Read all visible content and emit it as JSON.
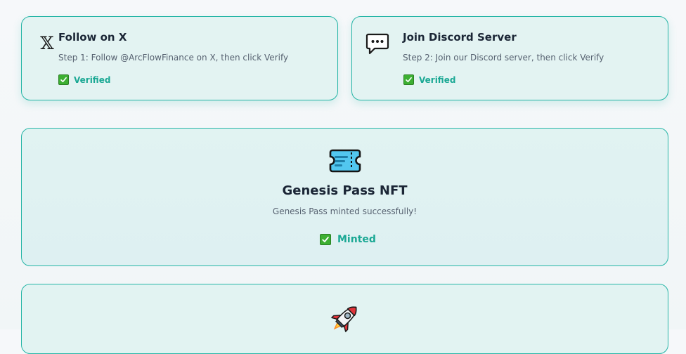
{
  "steps": [
    {
      "icon": "x-logo-icon",
      "icon_glyph": "𝕏",
      "title": "Follow on X",
      "description": "Step 1: Follow @ArcFlowFinance on X, then click Verify",
      "status": "Verified"
    },
    {
      "icon": "chat-bubble-icon",
      "title": "Join Discord Server",
      "description": "Step 2: Join our Discord server, then click Verify",
      "status": "Verified"
    }
  ],
  "nft": {
    "icon": "ticket-icon",
    "title": "Genesis Pass NFT",
    "description": "Genesis Pass minted successfully!",
    "status": "Minted"
  },
  "next_section": {
    "icon": "rocket-icon"
  },
  "colors": {
    "card_border": "#25b5a6",
    "card_background": "#e3f3f2",
    "status_text": "#1aa894",
    "check_green": "#3daf32",
    "title_text": "#1b2636",
    "description_text": "#566170"
  }
}
